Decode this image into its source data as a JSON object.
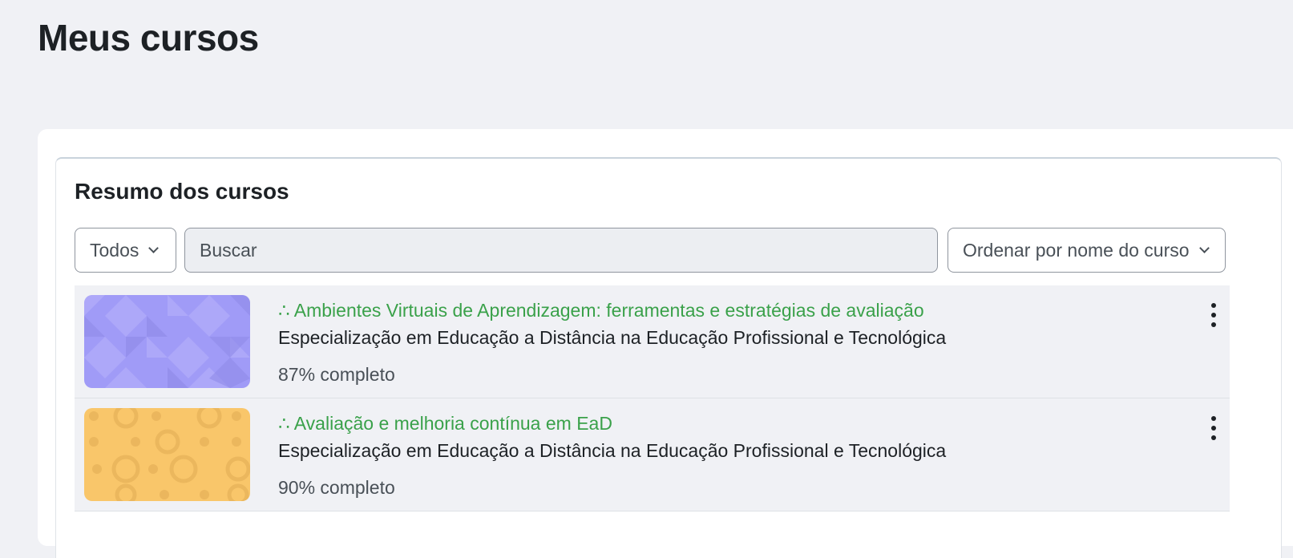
{
  "page": {
    "title": "Meus cursos"
  },
  "block": {
    "title": "Resumo dos cursos",
    "filter": {
      "selected": "Todos"
    },
    "search": {
      "placeholder": "Buscar",
      "value": ""
    },
    "sort": {
      "selected": "Ordenar por nome do curso"
    }
  },
  "courses": [
    {
      "name": "∴ Ambientes Virtuais de Aprendizagem: ferramentas e estratégias de avaliação",
      "category": "Especialização em Educação a Distância na Educação Profissional e Tecnológica",
      "progress": "87% completo",
      "progress_percent": 87,
      "thumb_color": "#a09bf7"
    },
    {
      "name": "∴ Avaliação e melhoria contínua em EaD",
      "category": "Especialização em Educação a Distância na Educação Profissional e Tecnológica",
      "progress": "90% completo",
      "progress_percent": 90,
      "thumb_color": "#f9c66a"
    }
  ],
  "colors": {
    "course_link": "#3aa14a",
    "page_bg": "#f0f1f5"
  },
  "icons": {
    "filter": "chevron-down-icon",
    "sort": "chevron-down-icon",
    "course_menu": "kebab-menu-icon"
  }
}
